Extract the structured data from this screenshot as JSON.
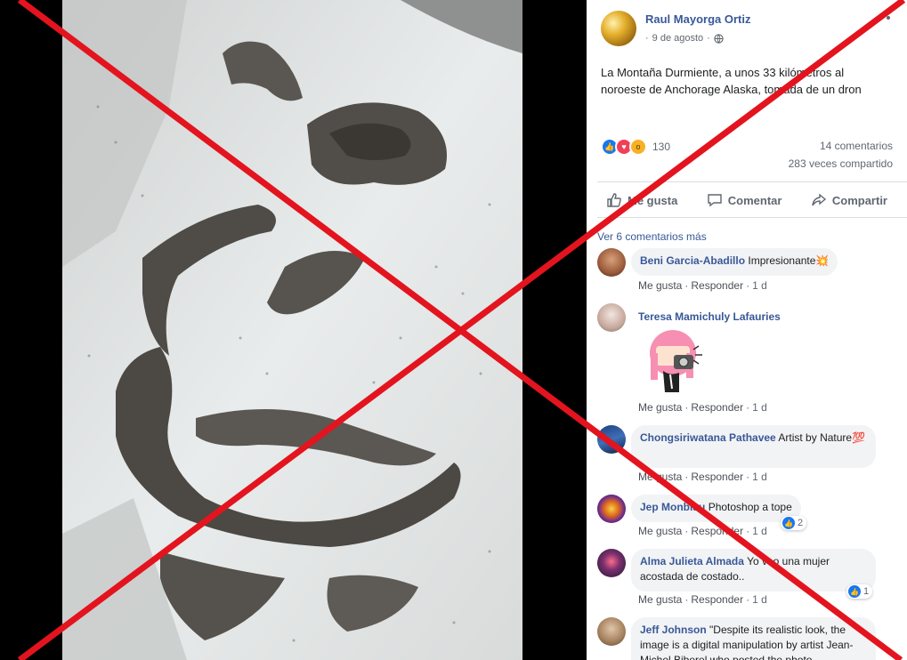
{
  "post": {
    "author": "Raul Mayorga Ortiz",
    "date": "9 de agosto",
    "text": "La Montaña Durmiente, a unos 33 kilómetros al noroeste de Anchorage Alaska, tomada de un dron",
    "reaction_count": "130",
    "comments_count": "14 comentarios",
    "shares_count": "283 veces compartido"
  },
  "actions": {
    "like": "Me gusta",
    "comment": "Comentar",
    "share": "Compartir"
  },
  "comments_header": {
    "more": "Ver 6 comentarios más"
  },
  "link_labels": {
    "like": "Me gusta",
    "reply": "Responder"
  },
  "comments": [
    {
      "name": "Beni Garcia-Abadillo",
      "text": "Impresionante💥",
      "time": "1 d",
      "reactions": ""
    },
    {
      "name": "Teresa Mamichuly Lafauries",
      "text": "",
      "time": "1 d",
      "reactions": ""
    },
    {
      "name": "Chongsiriwatana Pathavee",
      "text": "Artist by Nature💯",
      "time": "1 d",
      "reactions": ""
    },
    {
      "name": "Jep Monbiau",
      "text": "Photoshop a tope",
      "time": "1 d",
      "reactions": "2"
    },
    {
      "name": "Alma Julieta Almada",
      "text": "Yo veo una mujer acostada de costado..",
      "time": "1 d",
      "reactions": "1"
    },
    {
      "name": "Jeff Johnson",
      "text": "\"Despite its realistic look, the image is a digital manipulation by artist Jean-Michel Biberel who posted the photo",
      "time": "",
      "reactions": ""
    }
  ],
  "colors": {
    "facebook_blue": "#385898",
    "link_grey": "#606770",
    "overlay_red": "#e3141e"
  }
}
